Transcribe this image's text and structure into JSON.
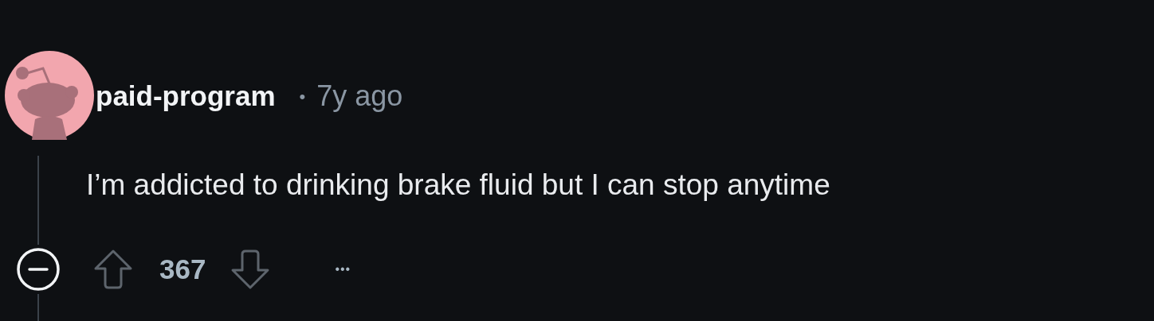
{
  "comment": {
    "author": "paid-program",
    "separator": "•",
    "time": "7y ago",
    "body": "I’m addicted to drinking brake fluid but I can stop anytime",
    "votes": "367",
    "more": "•••"
  }
}
